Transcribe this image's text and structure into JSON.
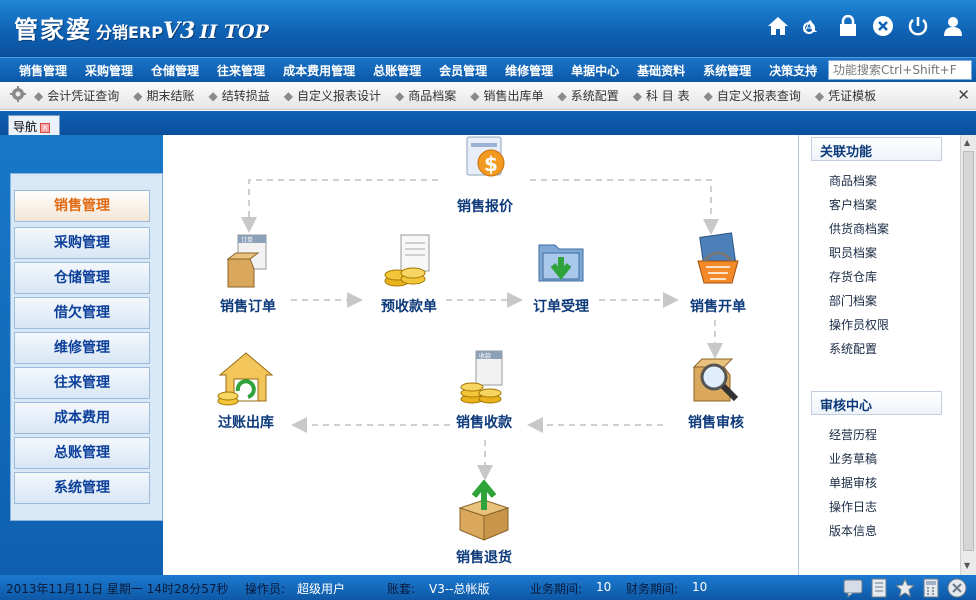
{
  "app": {
    "logo_main": "管家婆",
    "logo_sub": "分销ERP",
    "logo_v": "V3",
    "logo_ver": "II TOP"
  },
  "top_icons": [
    "home-icon",
    "font-icon",
    "lock-icon",
    "close-circle-icon",
    "power-icon",
    "user-icon"
  ],
  "menu": [
    "销售管理",
    "采购管理",
    "仓储管理",
    "往来管理",
    "成本费用管理",
    "总账管理",
    "会员管理",
    "维修管理",
    "单据中心",
    "基础资料",
    "系统管理",
    "决策支持"
  ],
  "search": {
    "placeholder": "功能搜索Ctrl+Shift+F"
  },
  "quickbar": [
    "会计凭证查询",
    "期末结账",
    "结转损益",
    "自定义报表设计",
    "商品档案",
    "销售出库单",
    "系统配置",
    "科 目 表",
    "自定义报表查询",
    "凭证模板"
  ],
  "tab": {
    "label": "导航"
  },
  "left_nav": {
    "items": [
      "销售管理",
      "采购管理",
      "仓储管理",
      "借欠管理",
      "维修管理",
      "往来管理",
      "成本费用",
      "总账管理",
      "系统管理"
    ]
  },
  "flow": {
    "quote": "销售报价",
    "order": "销售订单",
    "prepay": "预收款单",
    "accept": "订单受理",
    "invoice": "销售开单",
    "post": "过账出库",
    "collect": "销售收款",
    "audit": "销售审核",
    "return": "销售退货",
    "doc_label_order": "订单",
    "doc_label_collect": "收款"
  },
  "right": {
    "related": {
      "title": "关联功能",
      "links": [
        "商品档案",
        "客户档案",
        "供货商档案",
        "职员档案",
        "存货仓库",
        "部门档案",
        "操作员权限",
        "系统配置"
      ]
    },
    "audit": {
      "title": "审核中心",
      "links": [
        "经营历程",
        "业务草稿",
        "单据审核",
        "操作日志",
        "版本信息"
      ]
    }
  },
  "status": {
    "datetime": "2013年11月11日 星期一 14时28分57秒",
    "operator_label": "操作员:",
    "operator": "超级用户",
    "account_label": "账套:",
    "account": "V3--总帐版",
    "biz_period_label": "业务期间:",
    "biz_period": "10",
    "fin_period_label": "财务期间:",
    "fin_period": "10"
  },
  "colors": {
    "header": "#0f62b4",
    "nav_text": "#0c3f9a",
    "active_nav": "#e06a12",
    "flow_label": "#0d3a7a"
  }
}
